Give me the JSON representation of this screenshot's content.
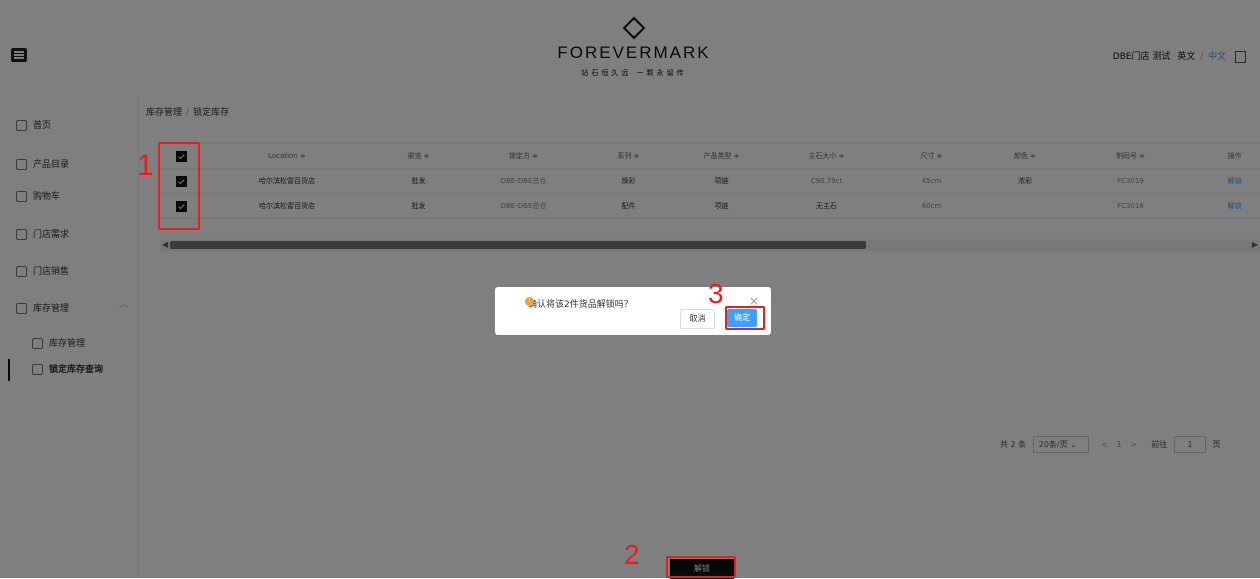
{
  "header": {
    "logo": "FOREVERMARK",
    "logo_sub": "钻石恒久远 一颗永留传",
    "user": "DBE门店 测试",
    "lang_en": "英文",
    "lang_sep": "/",
    "lang_zh": "中文"
  },
  "sidebar": {
    "items": [
      {
        "label": "首页"
      },
      {
        "label": "产品目录"
      },
      {
        "label": "购物车"
      },
      {
        "label": "门店需求"
      },
      {
        "label": "门店销售"
      },
      {
        "label": "库存管理"
      },
      {
        "label": "库存管理"
      },
      {
        "label": "锁定库存查询"
      }
    ]
  },
  "breadcrumb": {
    "parent": "库存管理",
    "sep": "/",
    "current": "锁定库存"
  },
  "table": {
    "columns": [
      "Location ≑",
      "渠道 ≑",
      "锁定方 ≑",
      "系列 ≑",
      "产品类型 ≑",
      "主石大小 ≑",
      "尺寸 ≑",
      "颜色 ≑",
      "制码号 ≑",
      "操作"
    ],
    "rows": [
      {
        "location": "哈尔滨松雷百货店",
        "channel": "批发",
        "locker": "DBE-DBE总仓",
        "series": "焕彩",
        "type": "项链",
        "stone": "C90.79ct",
        "size": "45cm",
        "color": "浓彩",
        "code": "FC3019",
        "action": "解锁"
      },
      {
        "location": "哈尔滨松雷百货店",
        "channel": "批发",
        "locker": "DBE-DBE总仓",
        "series": "配件",
        "type": "项链",
        "stone": "无主石",
        "size": "60cm",
        "color": "",
        "code": "FC3018",
        "action": "解锁"
      }
    ]
  },
  "pagination": {
    "total": "共 2 条",
    "size": "20条/页",
    "page": "1",
    "goto": "前往",
    "goto_val": "1",
    "suffix": "页",
    "prev": "<",
    "next": ">"
  },
  "footer": {
    "unlock": "解锁"
  },
  "dialog": {
    "message": "确认将该2件货品解锁吗？",
    "cancel": "取消",
    "confirm": "确定",
    "close": "×",
    "warn": "!"
  },
  "annotations": {
    "one": "1",
    "two": "2",
    "three": "3"
  },
  "colors": {
    "accent": "#409eff",
    "annotation": "#e51f1f",
    "warning": "#e6a23c"
  }
}
